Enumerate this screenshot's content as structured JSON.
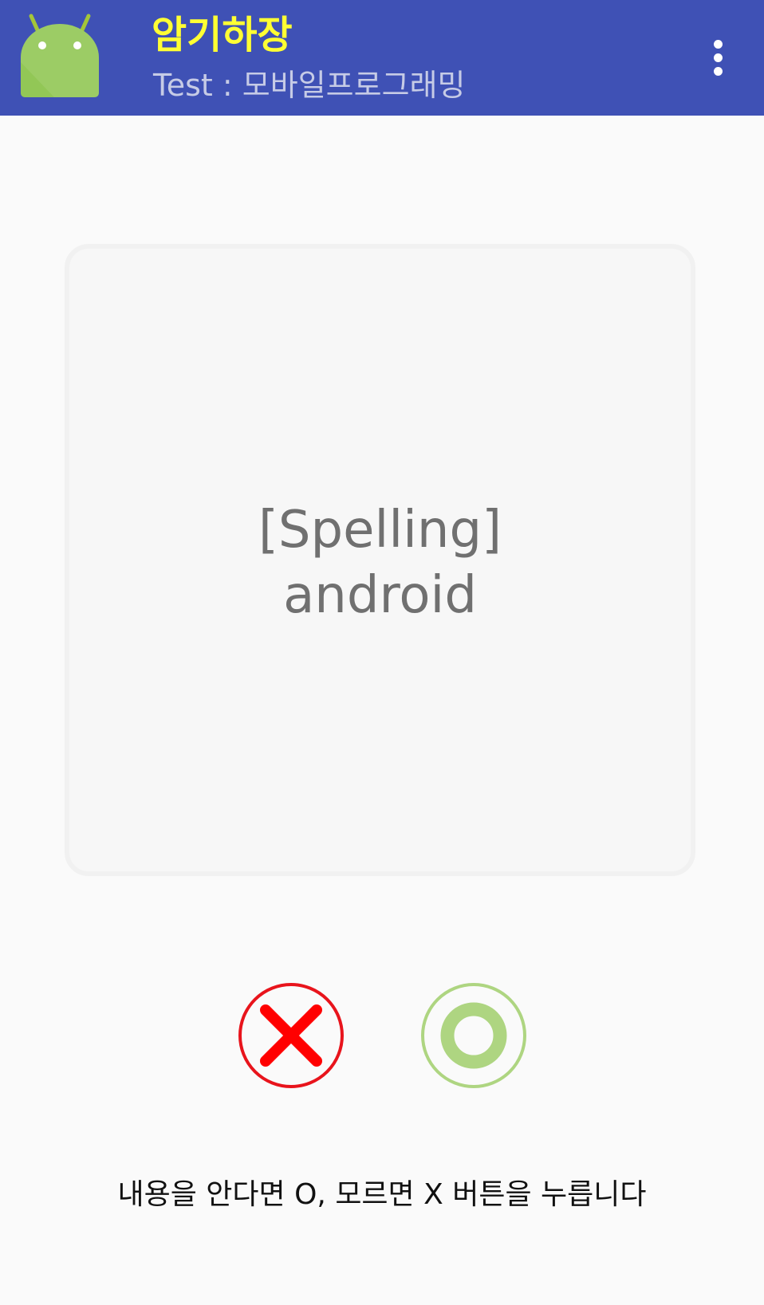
{
  "appbar": {
    "title": "암기하장",
    "subtitle": "Test : 모바일프로그래밍",
    "logo_icon": "android-robot-icon",
    "menu_icon": "more-vert-icon",
    "background_color": "#3f51b5",
    "title_color": "#ffff33"
  },
  "card": {
    "category": "[Spelling]",
    "word": "android"
  },
  "buttons": {
    "dont_know": {
      "icon": "x-mark-icon",
      "color": "#e8141c"
    },
    "know": {
      "icon": "o-circle-icon",
      "color": "#aed581"
    }
  },
  "instruction": "내용을 안다면 O, 모르면 X 버튼을 누릅니다"
}
